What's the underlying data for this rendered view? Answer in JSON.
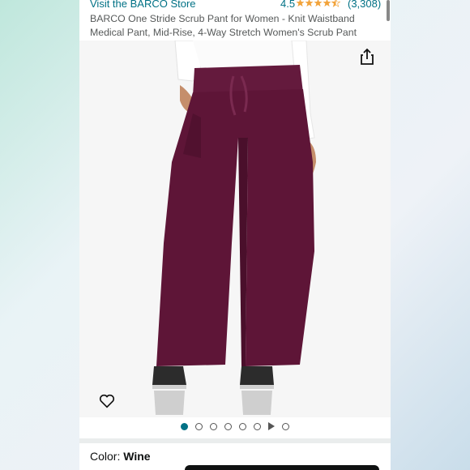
{
  "store": {
    "link": "Visit the BARCO Store",
    "rating": "4.5",
    "review_count": "(3,308)"
  },
  "product": {
    "title": "BARCO One Stride Scrub Pant for Women - Knit Waistband Medical Pant, Mid-Rise, 4-Way Stretch Women's Scrub Pant"
  },
  "gallery": {
    "image_count": 8,
    "active_index": 0
  },
  "color": {
    "label": "Color: ",
    "value": "Wine"
  },
  "icons": [
    "share-icon",
    "heart-icon",
    "play-icon"
  ],
  "colors": {
    "link": "#007185",
    "star": "#f2a33a",
    "pants": "#5e1537"
  }
}
